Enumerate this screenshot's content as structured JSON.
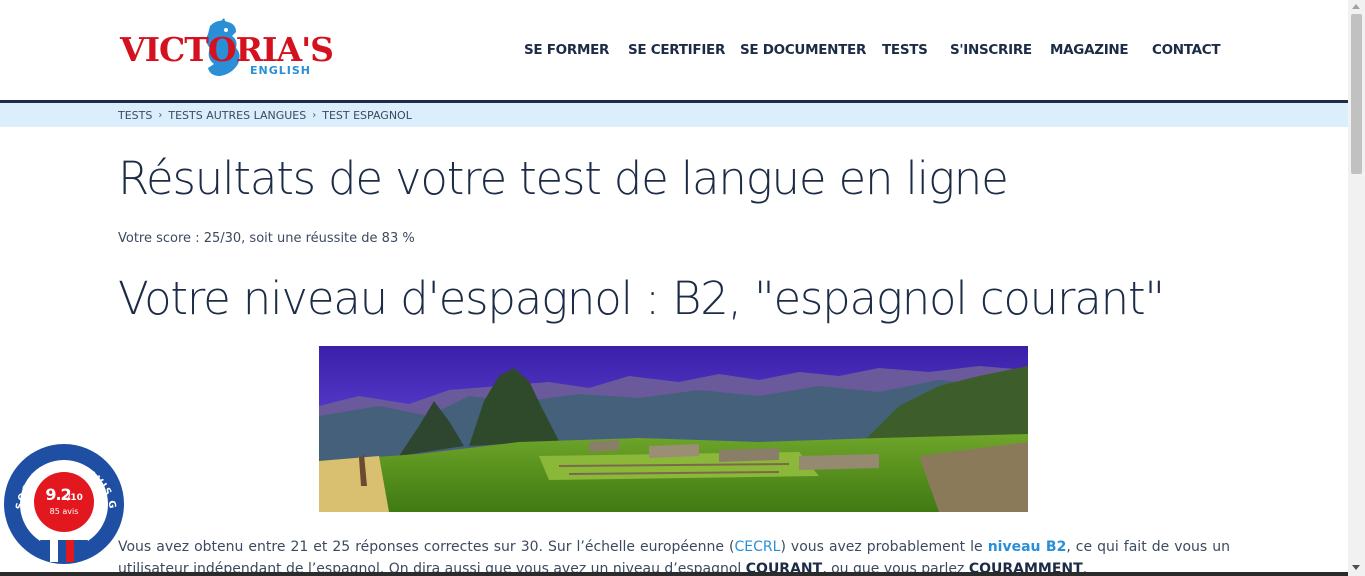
{
  "brand": {
    "name": "VICTORIA'S",
    "sub": "ENGLISH",
    "colors": {
      "red": "#d4121f",
      "blue": "#2a8fd6",
      "navy": "#1c2b46",
      "breadcrumb_bg": "#daeefb"
    }
  },
  "nav": {
    "items": [
      {
        "label": "SE FORMER"
      },
      {
        "label": "SE CERTIFIER"
      },
      {
        "label": "SE DOCUMENTER"
      },
      {
        "label": "TESTS"
      },
      {
        "label": "S'INSCRIRE"
      },
      {
        "label": "MAGAZINE"
      },
      {
        "label": "CONTACT"
      }
    ]
  },
  "breadcrumb": {
    "items": [
      {
        "label": "TESTS"
      },
      {
        "label": "TESTS AUTRES LANGUES"
      },
      {
        "label": "TEST ESPAGNOL"
      }
    ],
    "separator": "›"
  },
  "main": {
    "title": "Résultats de votre test de langue en ligne",
    "score": "Votre score : 25/30, soit une réussite de 83 %",
    "level_heading": "Votre niveau d'espagnol : B2, \"espagnol courant\"",
    "image_icon": "machu-picchu-panorama-image",
    "paragraph": {
      "p1": "Vous avez obtenu entre 21 et 25 réponses correctes sur 30. Sur l’échelle européenne (",
      "link_cecrl": "CECRL",
      "p2": ") vous avez probablement le ",
      "link_level": "niveau B2",
      "p3": ", ce qui fait de vous un utilisateur indépendant de l’espagnol. On dira aussi que vous avez un niveau d’espagnol ",
      "bold1": "COURANT",
      "p4": ", ou que vous parlez ",
      "bold2": "COURAMMENT",
      "p5": "."
    }
  },
  "badge": {
    "arc_text": "SOCIÉTÉ DES AVIS GARANTIS",
    "score": "9.2",
    "out_of": "/10",
    "count": "85 avis",
    "colors": {
      "ring": "#1f4fa3",
      "center": "#e3171e"
    }
  }
}
